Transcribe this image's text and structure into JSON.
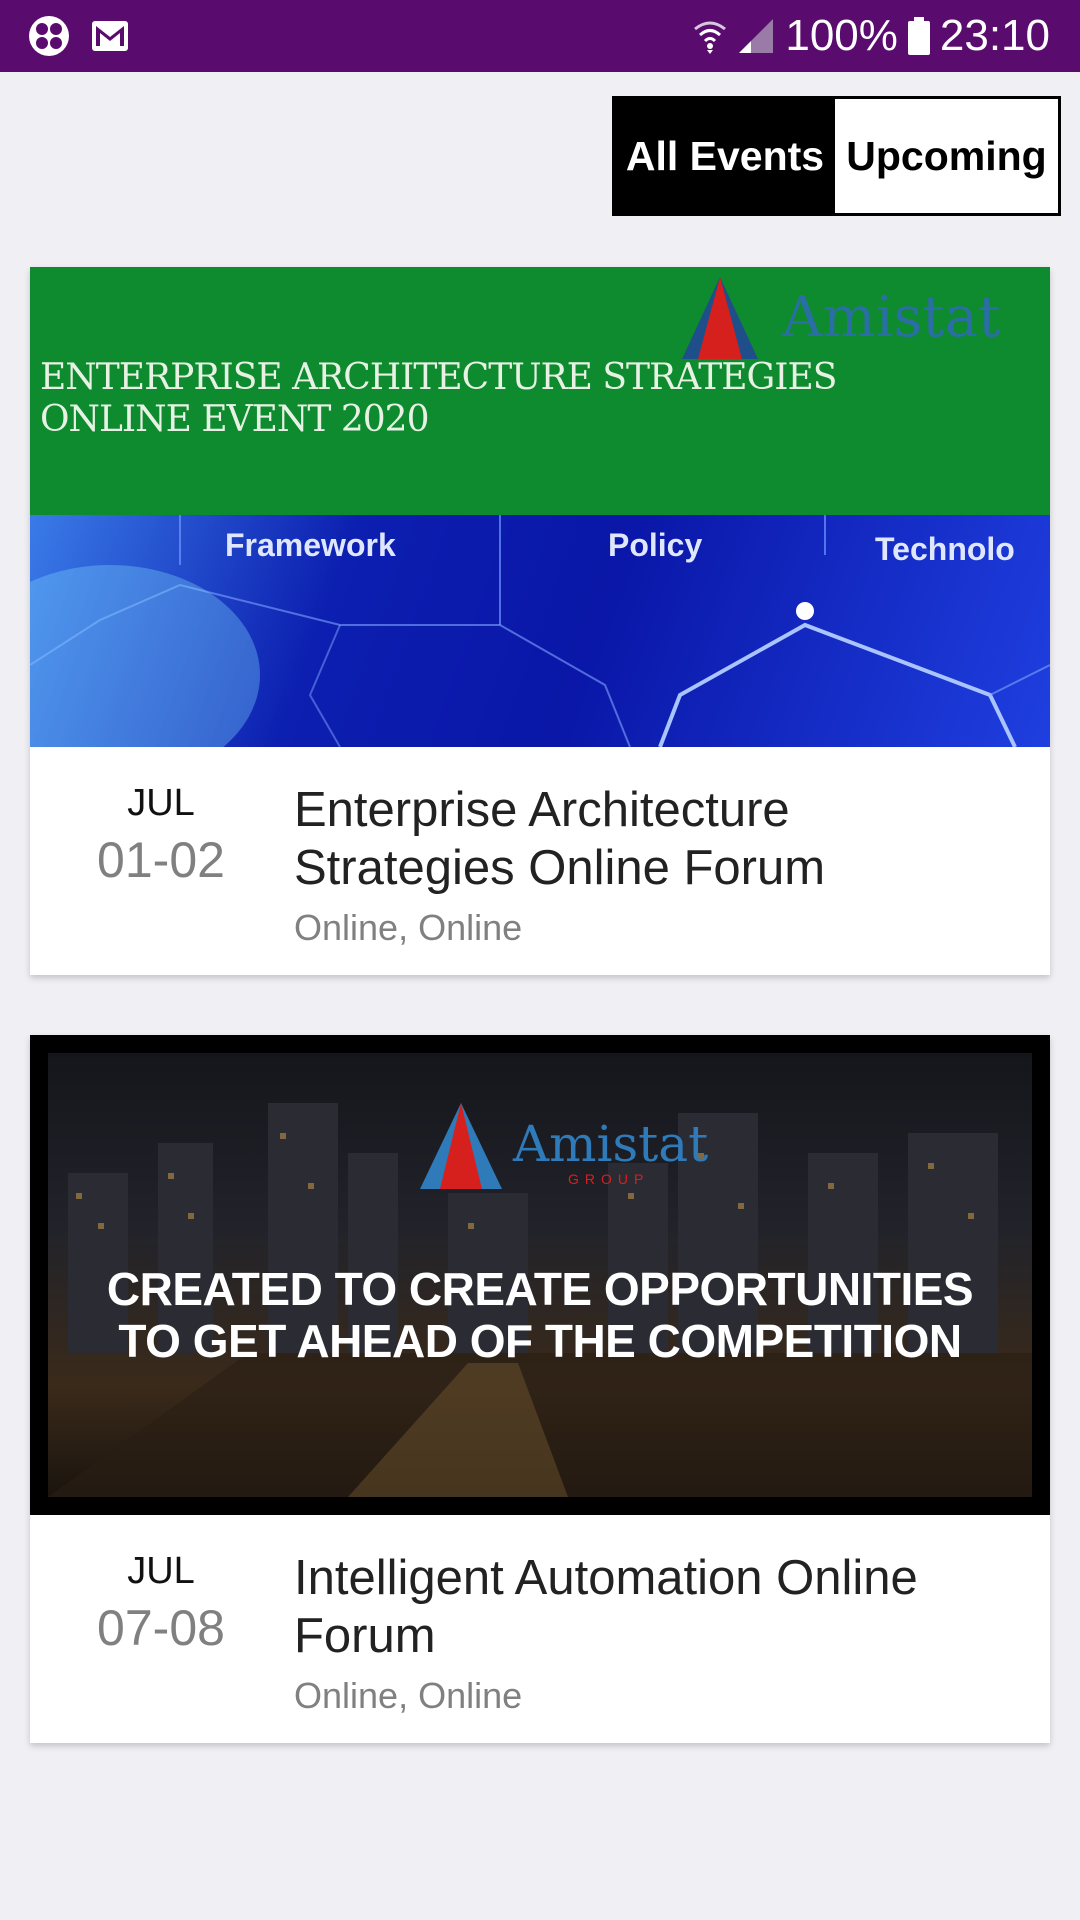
{
  "status_bar": {
    "battery": "100%",
    "time": "23:10",
    "icons": [
      "app-icon",
      "gmail-icon",
      "wifi-icon",
      "signal-icon",
      "battery-icon"
    ]
  },
  "segmented": {
    "all_label": "All Events",
    "upcoming_label": "Upcoming",
    "selected": "All Events"
  },
  "events": [
    {
      "month": "JUL",
      "days": "01-02",
      "title": "Enterprise Architecture Strategies Online Forum",
      "location": "Online, Online",
      "image": {
        "headline_line1": "ENTERPRISE ARCHITECTURE STRATEGIES",
        "headline_line2": "ONLINE EVENT 2020",
        "brand": "Amistat",
        "labels": [
          "Framework",
          "Policy",
          "Technolo"
        ]
      }
    },
    {
      "month": "JUL",
      "days": "07-08",
      "title": "Intelligent Automation Online Forum",
      "location": "Online, Online",
      "image": {
        "brand": "Amistat",
        "brand_sub": "GROUP",
        "headline_line1": "CREATED TO CREATE OPPORTUNITIES",
        "headline_line2": "TO GET AHEAD OF THE COMPETITION"
      }
    }
  ],
  "colors": {
    "status_bar": "#5a0b6e",
    "background": "#efeff4",
    "segment_active": "#000000"
  }
}
